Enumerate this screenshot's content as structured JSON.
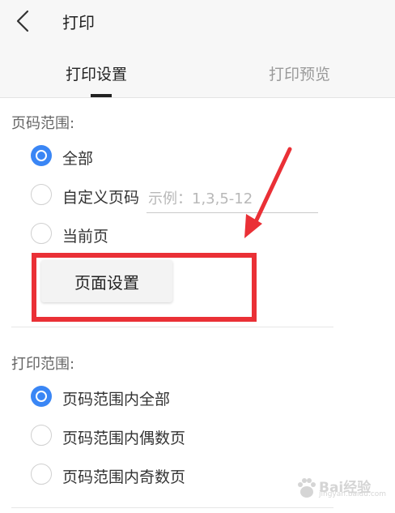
{
  "header": {
    "title": "打印",
    "tabs": [
      {
        "label": "打印设置",
        "active": true
      },
      {
        "label": "打印预览",
        "active": false
      }
    ]
  },
  "page_range": {
    "label": "页码范围:",
    "options": [
      {
        "label": "全部",
        "checked": true
      },
      {
        "label": "自定义页码",
        "checked": false
      },
      {
        "label": "当前页",
        "checked": false
      }
    ],
    "custom_placeholder": "示例：1,3,5-12",
    "custom_value": ""
  },
  "page_setup": {
    "label": "页面设置"
  },
  "print_range": {
    "label": "打印范围:",
    "options": [
      {
        "label": "页码范围内全部",
        "checked": true
      },
      {
        "label": "页码范围内偶数页",
        "checked": false
      },
      {
        "label": "页码范围内奇数页",
        "checked": false
      }
    ]
  },
  "annotation": {
    "color": "#ea3036"
  },
  "accent_color": "#3a86f5",
  "watermark": {
    "text": "Bai经验",
    "sub": "jingyan.baidu.com"
  }
}
